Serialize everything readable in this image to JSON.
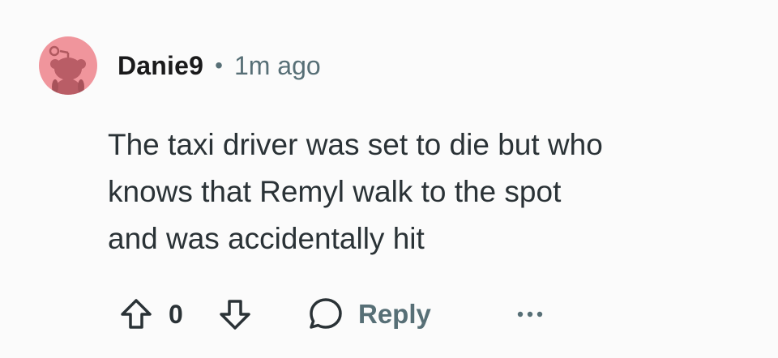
{
  "comment": {
    "author": "Danie9",
    "separator": "•",
    "timestamp": "1m ago",
    "body_lines": [
      "The taxi driver was set to die but who",
      "knows that Remyl walk to the spot",
      "and was accidentally hit"
    ],
    "score": "0",
    "reply_label": "Reply",
    "avatar_color": "#f0959c"
  },
  "icons": {
    "upvote": "arrow-up-outline-icon",
    "downvote": "arrow-down-outline-icon",
    "reply": "speech-bubble-icon",
    "more": "horizontal-ellipsis-icon"
  }
}
